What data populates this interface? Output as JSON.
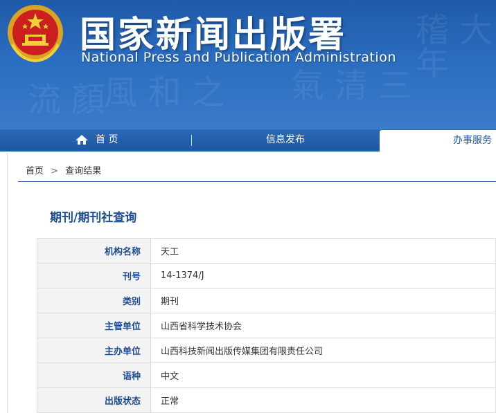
{
  "header": {
    "title": "国家新闻出版署",
    "subtitle": "National Press and Publication Administration"
  },
  "nav": {
    "home": "首 页",
    "info": "信息发布",
    "service": "办事服务"
  },
  "breadcrumb": {
    "home": "首页",
    "separator": ">",
    "current": "查询结果"
  },
  "section_title": "期刊/期刊社查询",
  "details": [
    {
      "label": "机构名称",
      "value": "天工"
    },
    {
      "label": "刊号",
      "value": "14-1374/J"
    },
    {
      "label": "类别",
      "value": "期刊"
    },
    {
      "label": "主管单位",
      "value": "山西省科学技术协会"
    },
    {
      "label": "主办单位",
      "value": "山西科技新闻出版传媒集团有限责任公司"
    },
    {
      "label": "语种",
      "value": "中文"
    },
    {
      "label": "出版状态",
      "value": "正常"
    }
  ],
  "colors": {
    "banner": "#2a6cbf",
    "nav": "#1d56a0",
    "accent_text": "#1d4e92",
    "label_bg": "#f3f3f3"
  }
}
